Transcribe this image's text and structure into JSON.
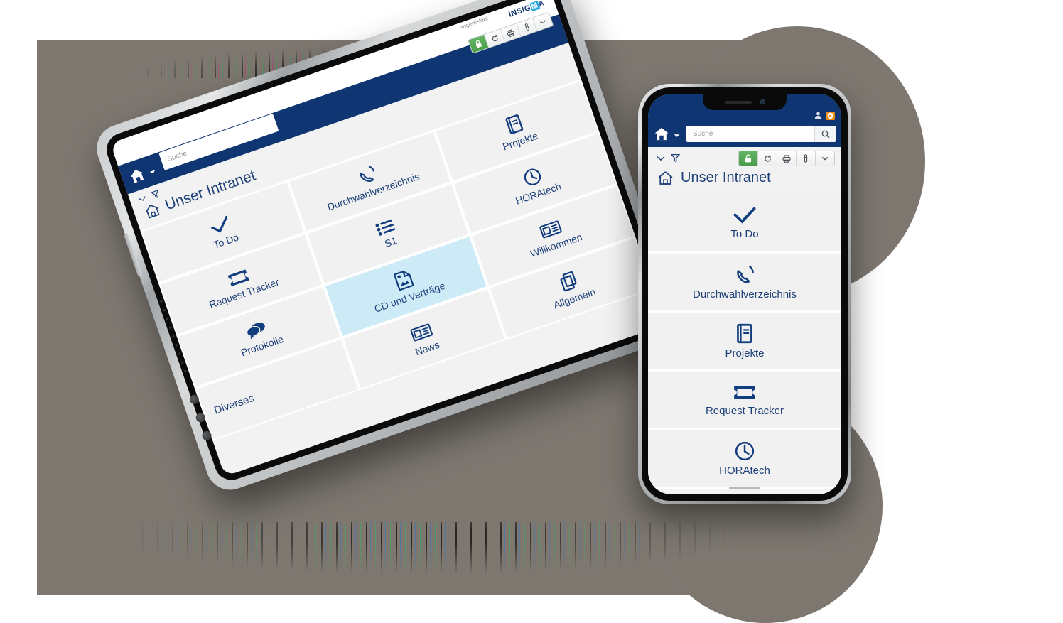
{
  "theme": {
    "brand_blue": "#0f3572",
    "icon_blue": "#123d7e",
    "highlight_tile": "#cdeaf7",
    "tile_grey": "#f1f1f1",
    "backdrop_grey": "#7d7770",
    "toolbar_green": "#4a9e4a",
    "badge_orange": "#eb8f1a",
    "logo_accent": "#2aa9e0"
  },
  "tablet": {
    "logo": {
      "text_before": "INSIG",
      "accent_letter": "M",
      "text_after": "A"
    },
    "user_label": "Angemeldet",
    "toolbar": [
      {
        "name": "lock-icon",
        "glyph": "🔒",
        "state": "active"
      },
      {
        "name": "refresh-icon",
        "glyph": "⟳",
        "state": "normal"
      },
      {
        "name": "print-icon",
        "glyph": "⎙",
        "state": "normal"
      },
      {
        "name": "info-icon",
        "glyph": "ℹ",
        "state": "normal"
      },
      {
        "name": "chevron-down-icon",
        "glyph": "▾",
        "state": "normal"
      }
    ],
    "nav": {
      "home_icon": "home-icon",
      "caret_icon": "chevron-down-icon",
      "search_placeholder": "Suche"
    },
    "filter_row": {
      "collapse_icon": "chevron-down-icon",
      "filter_icon": "funnel-icon"
    },
    "page_title": "Unser Intranet",
    "tiles": [
      {
        "label": "To Do",
        "icon": "check-icon",
        "highlighted": false,
        "kind": "tile"
      },
      {
        "label": "Durchwahlverzeichnis",
        "icon": "phone-icon",
        "highlighted": false,
        "kind": "tile"
      },
      {
        "label": "Projekte",
        "icon": "book-icon",
        "highlighted": false,
        "kind": "tile"
      },
      {
        "label": "Request Tracker",
        "icon": "ticket-icon",
        "highlighted": false,
        "kind": "tile"
      },
      {
        "label": "S1",
        "icon": "list-icon",
        "highlighted": false,
        "kind": "tile"
      },
      {
        "label": "HORAtech",
        "icon": "clock-icon",
        "highlighted": false,
        "kind": "tile"
      },
      {
        "label": "Protokolle",
        "icon": "chat-icon",
        "highlighted": false,
        "kind": "tile"
      },
      {
        "label": "CD und Verträge",
        "icon": "document-icon",
        "highlighted": true,
        "kind": "tile"
      },
      {
        "label": "Willkommen",
        "icon": "newspaper-icon",
        "highlighted": false,
        "kind": "tile"
      },
      {
        "label": "Diverses",
        "icon": "",
        "highlighted": false,
        "kind": "section"
      },
      {
        "label": "News",
        "icon": "newspaper-icon",
        "highlighted": false,
        "kind": "tile"
      },
      {
        "label": "Allgemein",
        "icon": "copy-icon",
        "highlighted": false,
        "kind": "tile"
      }
    ]
  },
  "phone": {
    "status": {
      "user_icon": "user-icon",
      "badge_icon": "shield-icon"
    },
    "nav": {
      "home_icon": "home-icon",
      "caret_icon": "chevron-down-icon",
      "search_placeholder": "Suche",
      "search_button_icon": "search-icon"
    },
    "toolbar": [
      {
        "name": "lock-icon",
        "glyph": "🔒",
        "state": "active"
      },
      {
        "name": "refresh-icon",
        "glyph": "⟳",
        "state": "normal"
      },
      {
        "name": "print-icon",
        "glyph": "⎙",
        "state": "normal"
      },
      {
        "name": "info-icon",
        "glyph": "ℹ",
        "state": "normal"
      },
      {
        "name": "chevron-down-icon",
        "glyph": "▾",
        "state": "normal"
      }
    ],
    "filter_row": {
      "collapse_icon": "chevron-down-icon",
      "filter_icon": "funnel-icon"
    },
    "page_title": "Unser Intranet",
    "items": [
      {
        "label": "To Do",
        "icon": "check-icon"
      },
      {
        "label": "Durchwahlverzeichnis",
        "icon": "phone-icon"
      },
      {
        "label": "Projekte",
        "icon": "book-icon"
      },
      {
        "label": "Request Tracker",
        "icon": "ticket-icon"
      },
      {
        "label": "HORAtech",
        "icon": "clock-icon"
      }
    ]
  }
}
